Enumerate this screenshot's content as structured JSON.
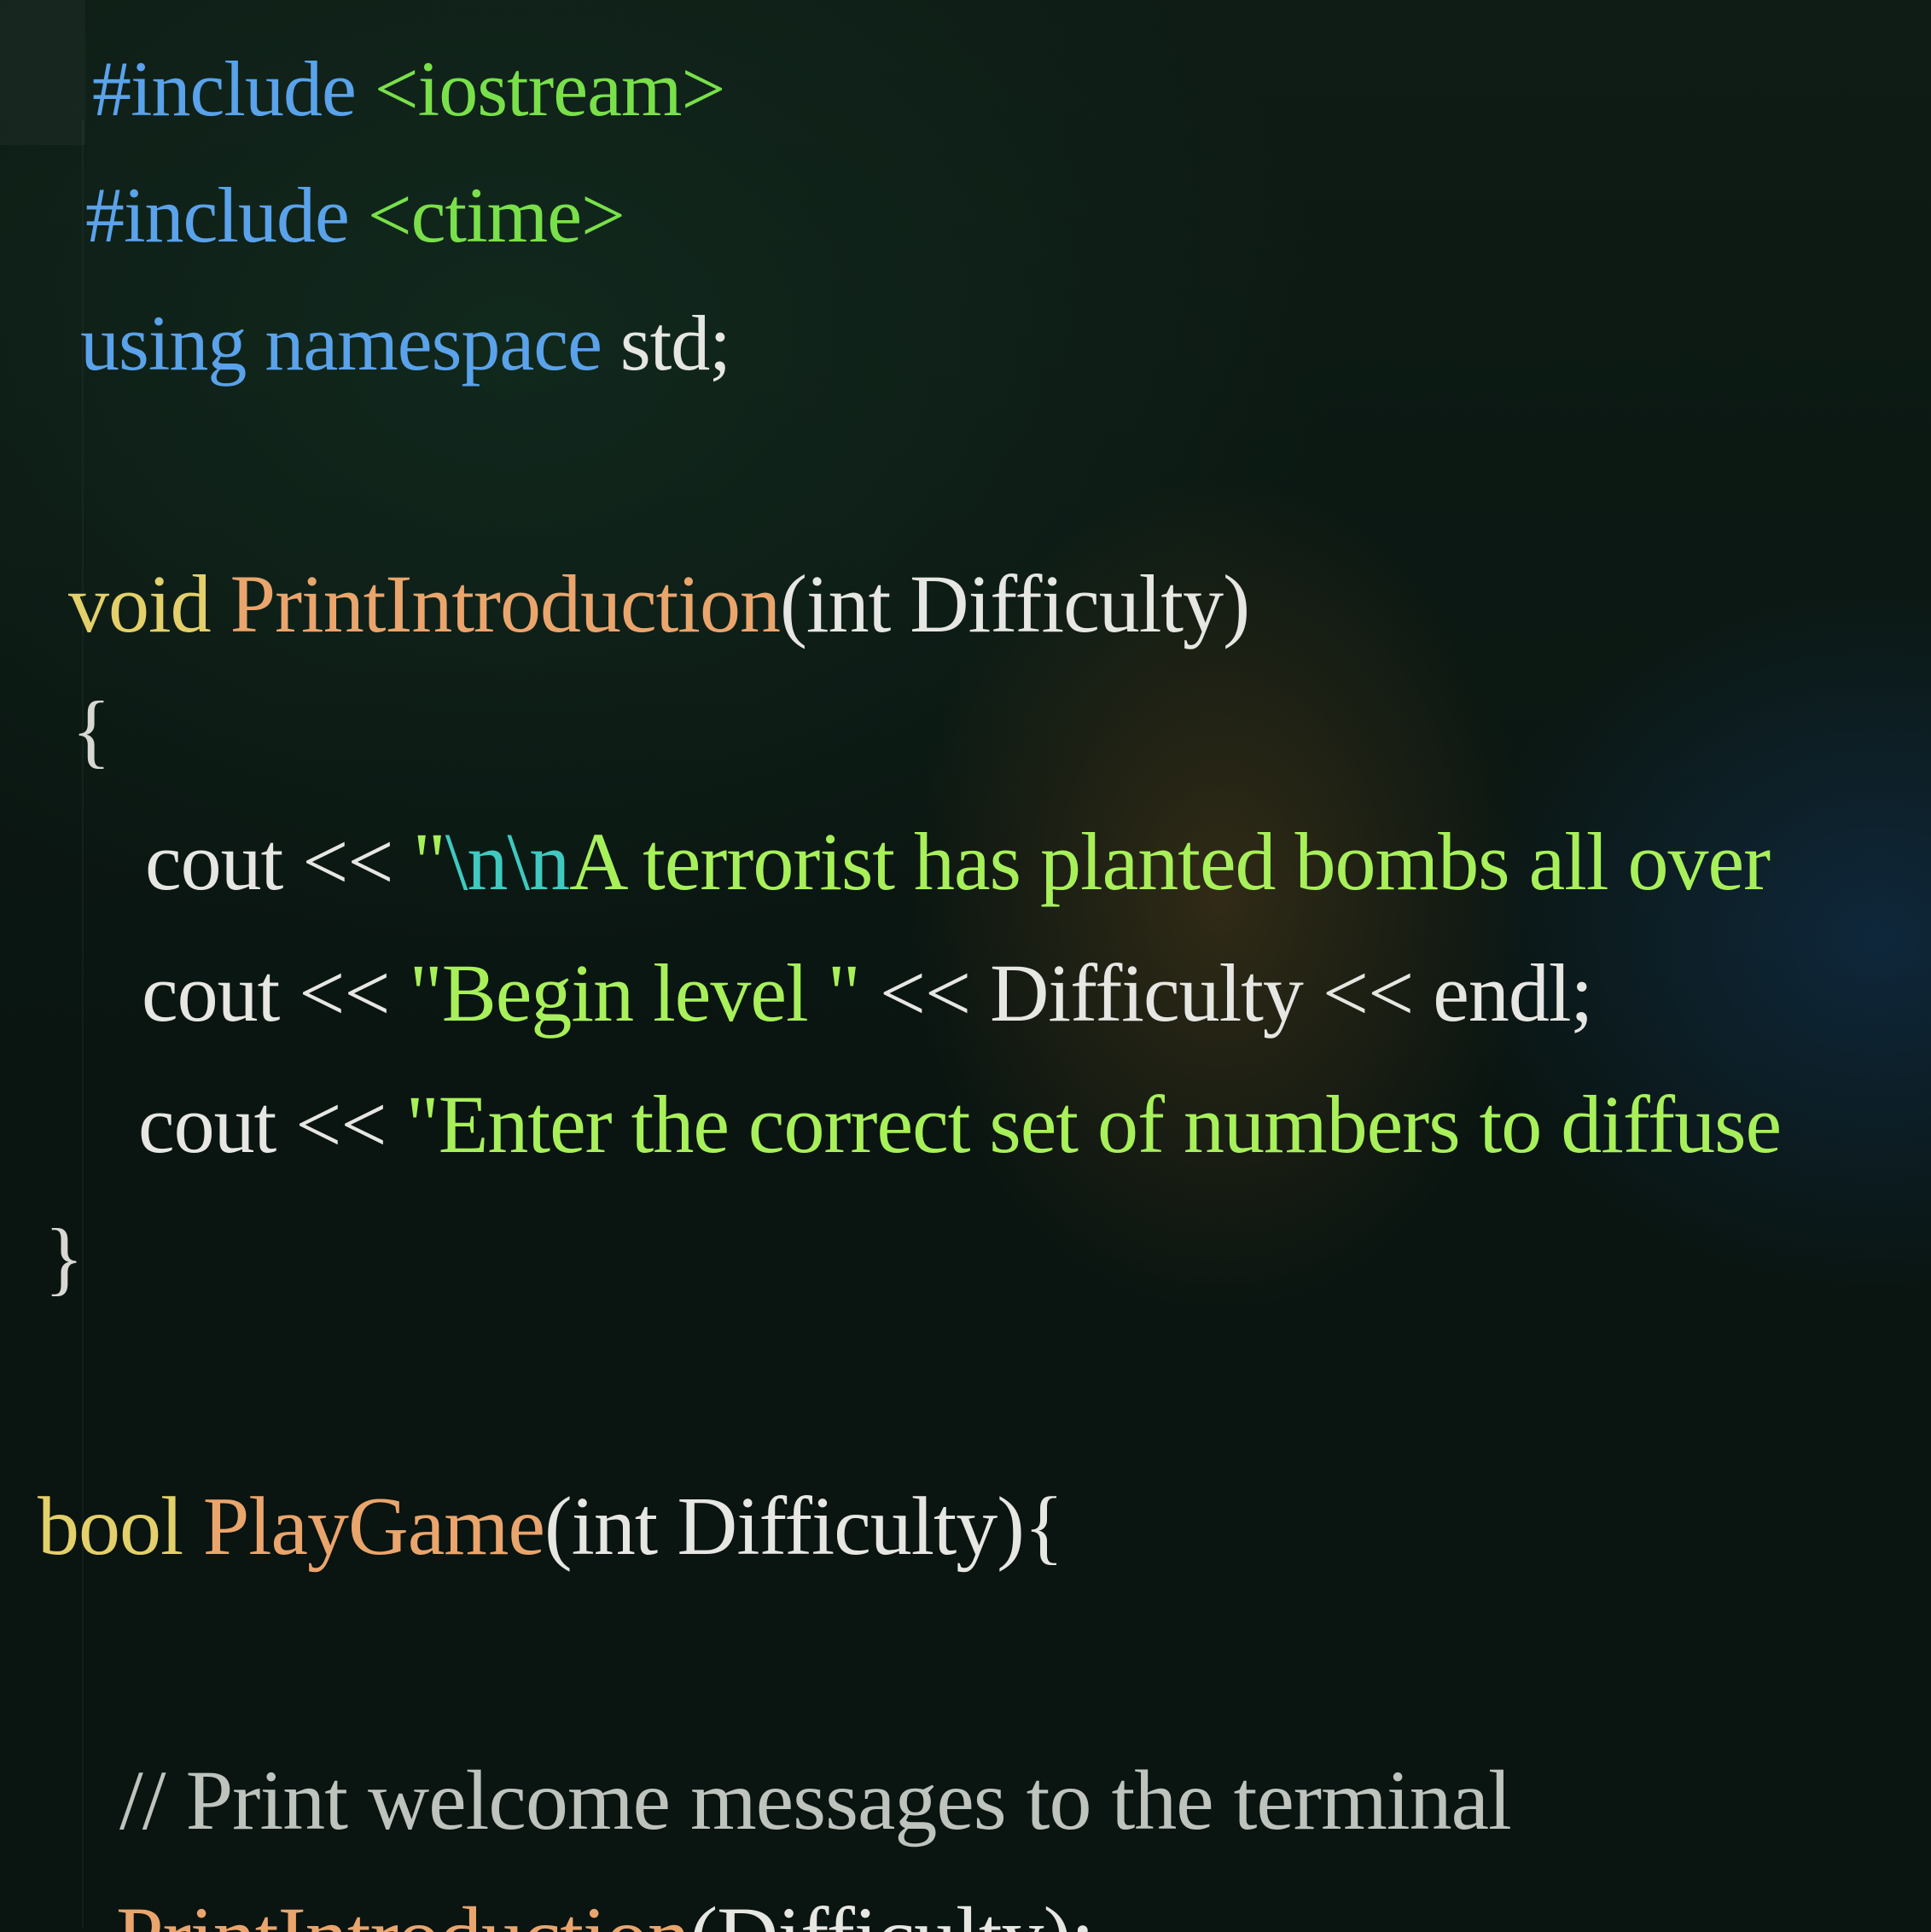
{
  "editor": {
    "lines": [
      {
        "id": "l1",
        "tokens": [
          {
            "t": "#include ",
            "c": "kw-blue"
          },
          {
            "t": "<iostream>",
            "c": "inc-green"
          }
        ]
      },
      {
        "id": "l2",
        "tokens": [
          {
            "t": "#include ",
            "c": "kw-blue"
          },
          {
            "t": "<ctime>",
            "c": "inc-green"
          }
        ]
      },
      {
        "id": "l3",
        "tokens": [
          {
            "t": "using namespace ",
            "c": "kw-blue"
          },
          {
            "t": "std;",
            "c": "plain"
          }
        ]
      },
      {
        "id": "l4",
        "tokens": [
          {
            "t": "void ",
            "c": "kw-yellow"
          },
          {
            "t": "PrintIntroduction",
            "c": "fn-orange"
          },
          {
            "t": "(int Difficulty)",
            "c": "plain"
          }
        ]
      },
      {
        "id": "l5",
        "tokens": [
          {
            "t": "{",
            "c": "brace"
          }
        ]
      },
      {
        "id": "l6",
        "tokens": [
          {
            "t": "cout << ",
            "c": "plain"
          },
          {
            "t": "\"",
            "c": "str-green"
          },
          {
            "t": "\\n\\n",
            "c": "esc-teal"
          },
          {
            "t": "A terrorist has planted bombs all over",
            "c": "str-green"
          }
        ]
      },
      {
        "id": "l7",
        "tokens": [
          {
            "t": "cout << ",
            "c": "plain"
          },
          {
            "t": "\"Begin level \"",
            "c": "str-green"
          },
          {
            "t": " << Difficulty << endl;",
            "c": "plain"
          }
        ]
      },
      {
        "id": "l8",
        "tokens": [
          {
            "t": "cout << ",
            "c": "plain"
          },
          {
            "t": "\"Enter the correct set of numbers to diffuse",
            "c": "str-green"
          }
        ]
      },
      {
        "id": "l9",
        "tokens": [
          {
            "t": "}",
            "c": "brace"
          }
        ]
      },
      {
        "id": "l10",
        "tokens": [
          {
            "t": "bool ",
            "c": "kw-yellow"
          },
          {
            "t": "PlayGame",
            "c": "fn-orange"
          },
          {
            "t": "(int Difficulty){",
            "c": "plain"
          }
        ]
      },
      {
        "id": "l11",
        "tokens": [
          {
            "t": "// Print welcome messages to the terminal",
            "c": "comment"
          }
        ]
      },
      {
        "id": "l12",
        "tokens": [
          {
            "t": "PrintIntroduction",
            "c": "fn-orange"
          },
          {
            "t": "(Difficulty);",
            "c": "plain"
          }
        ]
      }
    ]
  },
  "colors": {
    "background": "#0b1712",
    "keyword": "#5aa2ea",
    "include_path": "#79e04a",
    "type_keyword": "#e4d06a",
    "function_name": "#eaa56c",
    "string": "#a8f05a",
    "escape": "#3fc9c0",
    "plain": "#e6e6e2",
    "comment": "#bfc3bd"
  }
}
